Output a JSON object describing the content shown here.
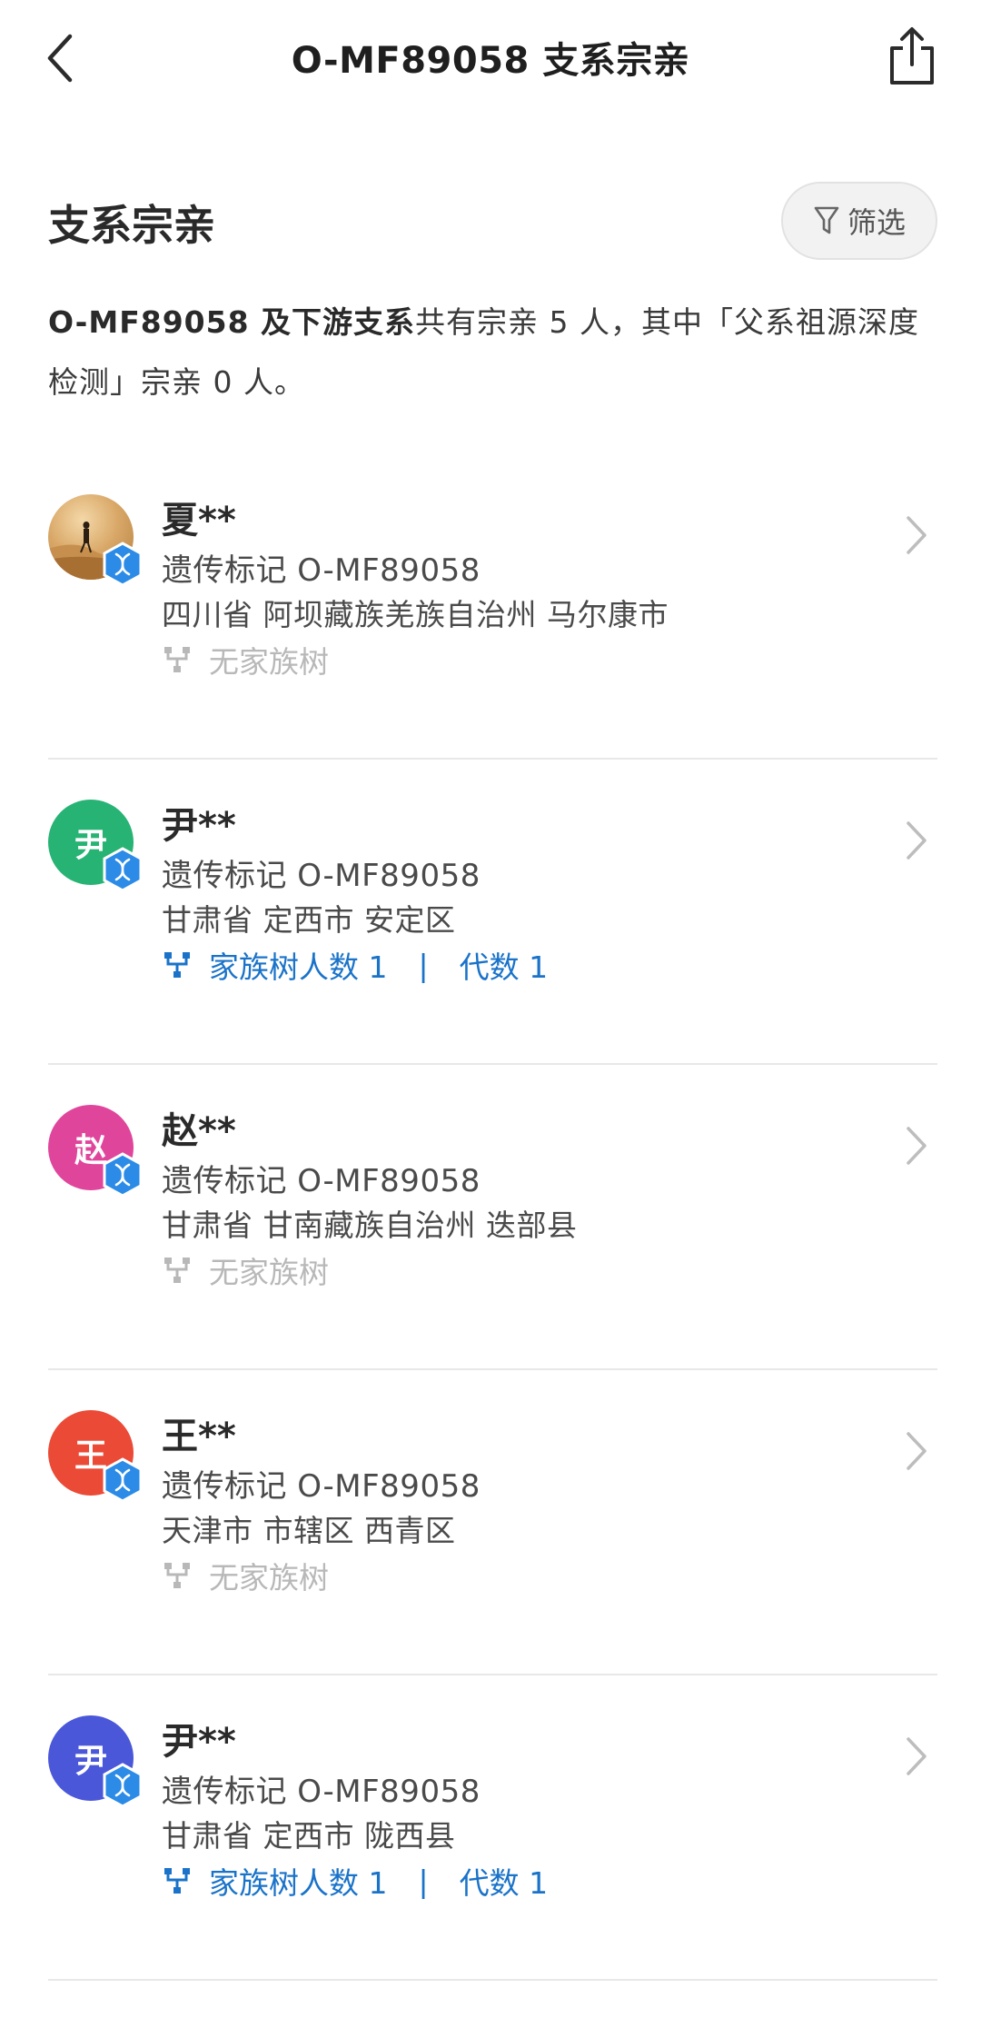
{
  "header": {
    "title": "O-MF89058 支系宗亲",
    "back_icon": "chevron-left-icon",
    "share_icon": "share-icon"
  },
  "section": {
    "title": "支系宗亲",
    "filter_label": "筛选",
    "filter_icon": "filter-icon"
  },
  "summary": {
    "part1": "O-MF89058 及下游支系",
    "part2": "共有宗亲 5 人，其中「父系祖源深度检测」宗亲 0 人。"
  },
  "colors": {
    "accent_blue": "#1a73c9",
    "badge_blue": "#2b8be6",
    "muted": "#b8b8b8"
  },
  "relatives": [
    {
      "name": "夏**",
      "avatar_text": "",
      "avatar_type": "photo",
      "marker": "遗传标记 O-MF89058",
      "location": "四川省 阿坝藏族羌族自治州 马尔康市",
      "tree_status": "none",
      "tree_text": "无家族树",
      "tree_count": "",
      "tree_gen": ""
    },
    {
      "name": "尹**",
      "avatar_text": "尹",
      "avatar_color": "#27b374",
      "marker": "遗传标记 O-MF89058",
      "location": "甘肃省 定西市 安定区",
      "tree_status": "has",
      "tree_text": "",
      "tree_count": "家族树人数 1",
      "tree_gen": "代数 1"
    },
    {
      "name": "赵**",
      "avatar_text": "赵",
      "avatar_color": "#e0459c",
      "marker": "遗传标记 O-MF89058",
      "location": "甘肃省 甘南藏族自治州 迭部县",
      "tree_status": "none",
      "tree_text": "无家族树",
      "tree_count": "",
      "tree_gen": ""
    },
    {
      "name": "王**",
      "avatar_text": "王",
      "avatar_color": "#ea4a36",
      "marker": "遗传标记 O-MF89058",
      "location": "天津市 市辖区 西青区",
      "tree_status": "none",
      "tree_text": "无家族树",
      "tree_count": "",
      "tree_gen": ""
    },
    {
      "name": "尹**",
      "avatar_text": "尹",
      "avatar_color": "#4a57d9",
      "marker": "遗传标记 O-MF89058",
      "location": "甘肃省 定西市 陇西县",
      "tree_status": "has",
      "tree_text": "",
      "tree_count": "家族树人数 1",
      "tree_gen": "代数 1"
    }
  ]
}
